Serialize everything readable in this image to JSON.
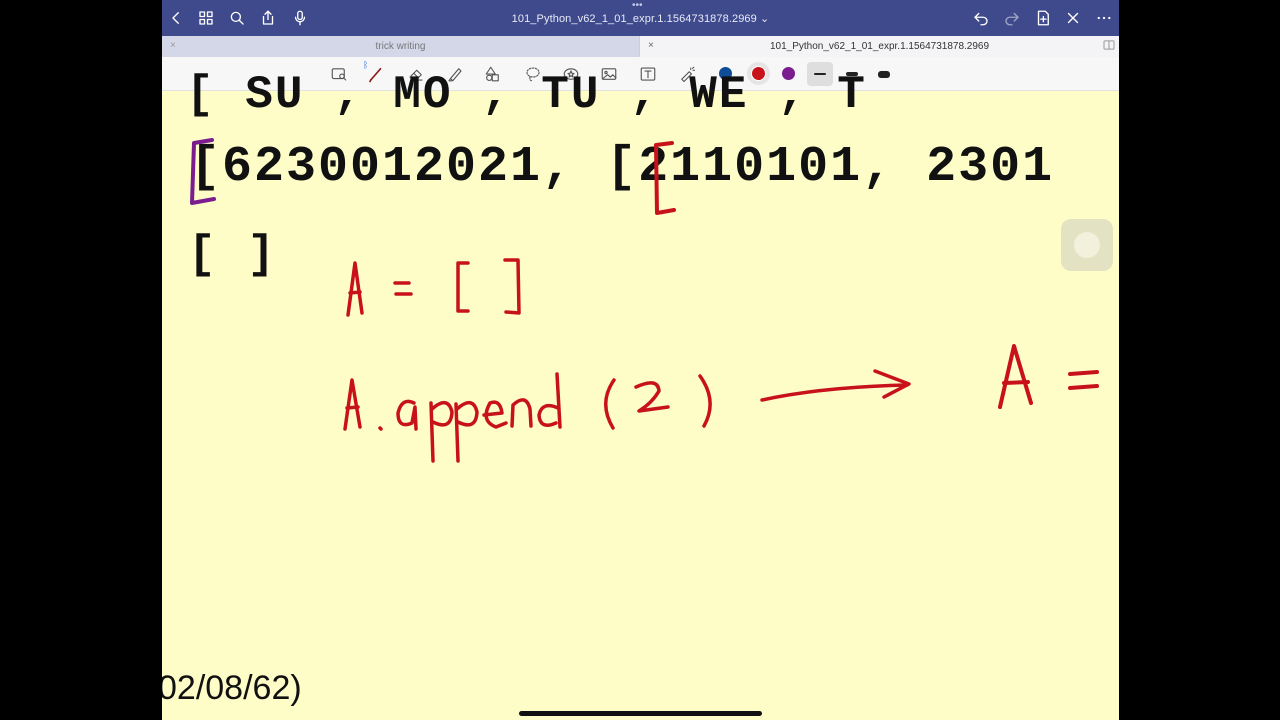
{
  "titlebar": {
    "document_title": "101_Python_v62_1_01_expr.1.1564731878.2969",
    "title_chevron": "⌄",
    "grabber": "•••",
    "left_icons": [
      "back-icon",
      "thumbnails-icon",
      "search-icon",
      "share-icon",
      "microphone-icon"
    ],
    "right_icons": [
      "undo-icon",
      "redo-icon",
      "add-page-icon",
      "close-icon",
      "more-icon"
    ]
  },
  "tabs": [
    {
      "label": "trick writing",
      "close": "×",
      "active": false
    },
    {
      "label": "101_Python_v62_1_01_expr.1.1564731878.2969",
      "close": "×",
      "active": true
    }
  ],
  "toolbar": {
    "tools": [
      "lasso-view-icon",
      "pen-icon",
      "eraser-icon",
      "highlighter-icon",
      "shapes-icon",
      "lasso-icon",
      "sticker-icon",
      "image-icon",
      "text-box-icon",
      "laser-pointer-icon"
    ],
    "colors": [
      "#0f4c97",
      "#c8121b",
      "#7b1c8f"
    ],
    "selected_color": "#c8121b",
    "stroke_sizes": [
      "thin",
      "medium",
      "thick"
    ],
    "selected_stroke": "thin"
  },
  "canvas": {
    "typed_lines": [
      "[ SU , MO , TU , WE , T",
      "[6230012021, [2110101, 2301",
      "[ ]"
    ],
    "footer_date": "02/08/62)",
    "ink_color": "#c8121b",
    "ink_accent": "#7b1c8f"
  }
}
